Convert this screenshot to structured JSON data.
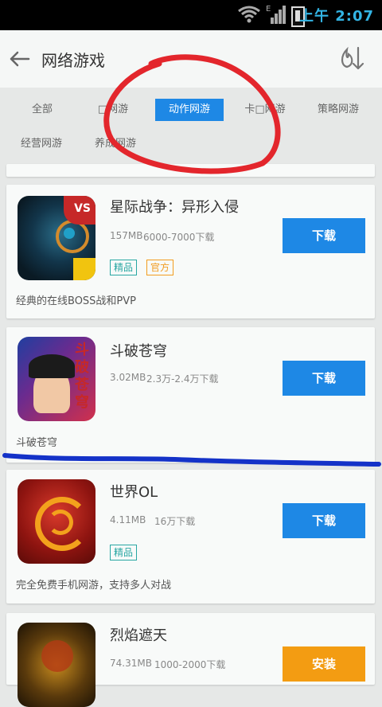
{
  "statusbar": {
    "time": "上午 2:07"
  },
  "header": {
    "title": "网络游戏"
  },
  "filters": {
    "items": [
      {
        "label": "全部"
      },
      {
        "label": "□网游"
      },
      {
        "label": "动作网游"
      },
      {
        "label": "卡□网游"
      },
      {
        "label": "策略网游"
      },
      {
        "label": "经营网游"
      },
      {
        "label": "养成网游"
      }
    ]
  },
  "apps": [
    {
      "name": "星际战争：异形入侵",
      "size": "157MB",
      "downloads": "6000-7000下载",
      "tags": [
        "精品",
        "官方"
      ],
      "button": "下载",
      "desc": "经典的在线BOSS战和PVP"
    },
    {
      "name": "斗破苍穹",
      "size": "3.02MB",
      "downloads": "2.3万-2.4万下载",
      "tags": [],
      "button": "下载",
      "desc": "斗破苍穹"
    },
    {
      "name": "世界OL",
      "size": "4.11MB",
      "downloads": "16万下载",
      "tags": [
        "精品"
      ],
      "button": "下载",
      "desc": "完全免费手机网游，支持多人对战"
    },
    {
      "name": "烈焰遮天",
      "size": "74.31MB",
      "downloads": "1000-2000下载",
      "tags": [],
      "button": "安装",
      "desc": ""
    }
  ],
  "icons": {
    "app1_badge": "VS",
    "app2_art": "斗破苍穹"
  },
  "colors": {
    "accent": "#1e88e5",
    "install": "#f39c12",
    "tag_green": "#28a7a3",
    "tag_orange": "#f29c1f",
    "marker_red": "#e3262c",
    "marker_blue": "#1432c8"
  }
}
